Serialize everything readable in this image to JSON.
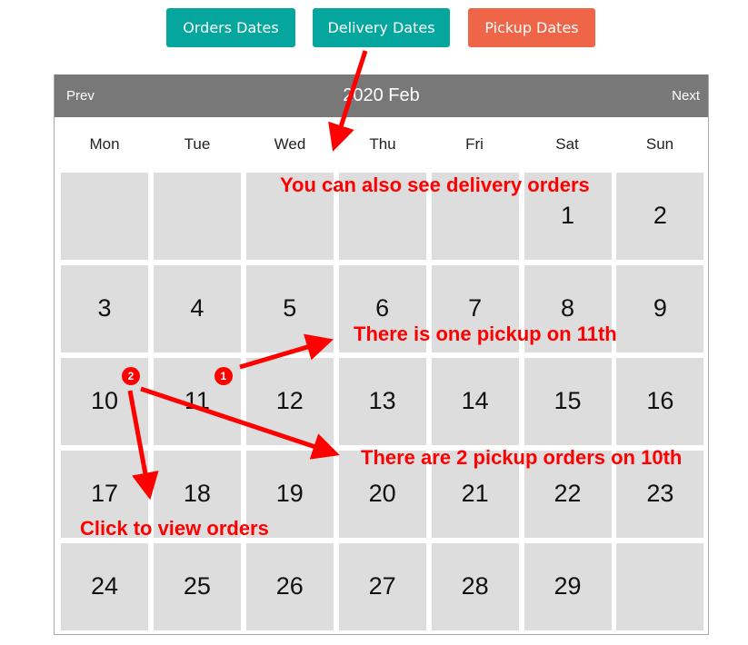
{
  "toolbar": {
    "orders_label": "Orders Dates",
    "delivery_label": "Delivery Dates",
    "pickup_label": "Pickup Dates"
  },
  "colors": {
    "teal": "#04a69d",
    "orange": "#ef6548",
    "header_gray": "#787878",
    "cell_gray": "#dddddd",
    "annotation_red": "#ff0000"
  },
  "calendar": {
    "prev_label": "Prev",
    "next_label": "Next",
    "title": "2020 Feb",
    "weekdays": [
      "Mon",
      "Tue",
      "Wed",
      "Thu",
      "Fri",
      "Sat",
      "Sun"
    ],
    "weeks": [
      [
        "",
        "",
        "",
        "",
        "",
        "1",
        "2"
      ],
      [
        "3",
        "4",
        "5",
        "6",
        "7",
        "8",
        "9"
      ],
      [
        "10",
        "11",
        "12",
        "13",
        "14",
        "15",
        "16"
      ],
      [
        "17",
        "18",
        "19",
        "20",
        "21",
        "22",
        "23"
      ],
      [
        "24",
        "25",
        "26",
        "27",
        "28",
        "29",
        ""
      ]
    ],
    "badges": [
      {
        "day": "10",
        "count": "2"
      },
      {
        "day": "11",
        "count": "1"
      }
    ]
  },
  "annotations": {
    "delivery_note": "You can also see delivery orders",
    "pickup_11_note": "There is one pickup on 11th",
    "pickup_10_note": "There are 2 pickup orders on 10th",
    "click_note": "Click to view orders"
  }
}
